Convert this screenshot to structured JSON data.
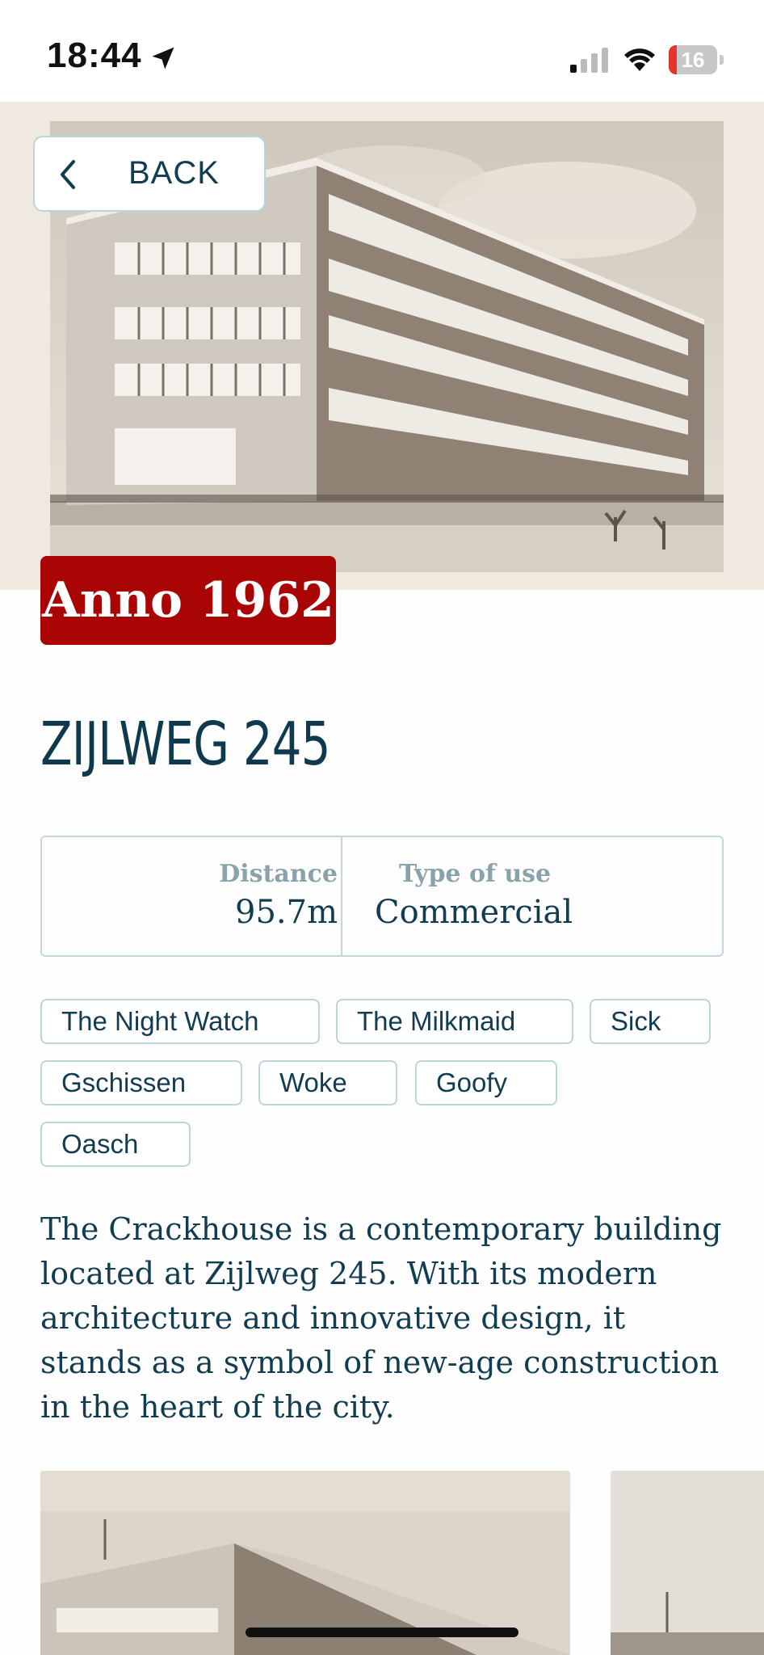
{
  "status_bar": {
    "time": "18:44",
    "battery_level": "16",
    "battery_fraction": 0.16,
    "icons": [
      "location-arrow-icon",
      "cellular-signal-icon",
      "wifi-icon",
      "battery-icon"
    ]
  },
  "header": {
    "back_label": "BACK",
    "back_icon": "chevron-left-icon"
  },
  "badge": {
    "label": "Anno 1962"
  },
  "building": {
    "title": "ZIJLWEG 245",
    "distance_label": "Distance",
    "distance_value": "95.7m",
    "type_label": "Type of use",
    "type_value": "Commercial"
  },
  "tags": [
    "The Night Watch",
    "The Milkmaid",
    "Sick",
    "Gschissen",
    "Woke",
    "Goofy",
    "Oasch"
  ],
  "description": "The Crackhouse is a contemporary building located at Zijlweg 245. With its modern architecture and innovative design, it stands as a symbol of new-age construction in the heart of the city.",
  "colors": {
    "primary": "#0f3a4e",
    "badge": "#aa0505",
    "border": "#bcd4dc",
    "muted": "#8aa2ac"
  }
}
